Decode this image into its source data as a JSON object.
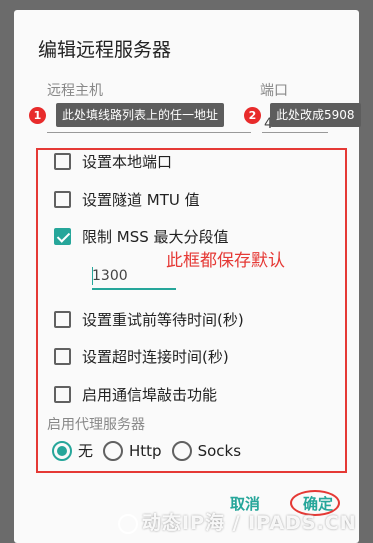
{
  "dialog": {
    "title": "编辑远程服务器",
    "host_label": "远程主机",
    "port_label": "端口",
    "port_value": "4",
    "tooltip_1_number": "1",
    "tooltip_1_text": "此处填线路列表上的任一地址",
    "tooltip_2_number": "2",
    "tooltip_2_text": "此处改成5908"
  },
  "options": [
    {
      "label": "设置本地端口",
      "checked": false
    },
    {
      "label": "设置隧道 MTU 值",
      "checked": false
    },
    {
      "label": "限制 MSS 最大分段值",
      "checked": true
    },
    {
      "label": "设置重试前等待时间(秒)",
      "checked": false
    },
    {
      "label": "设置超时连接时间(秒)",
      "checked": false
    },
    {
      "label": "启用通信埠敲击功能",
      "checked": false
    }
  ],
  "mss": {
    "value": "1300"
  },
  "annotation": "此框都保存默认",
  "proxy": {
    "label": "启用代理服务器",
    "options": [
      "无",
      "Http",
      "Socks"
    ],
    "selected": "无"
  },
  "buttons": {
    "cancel": "取消",
    "ok": "确定"
  },
  "watermark": "动态IP海 / IPADS.CN",
  "colors": {
    "accent": "#26a69a",
    "annotation": "#e53935"
  }
}
